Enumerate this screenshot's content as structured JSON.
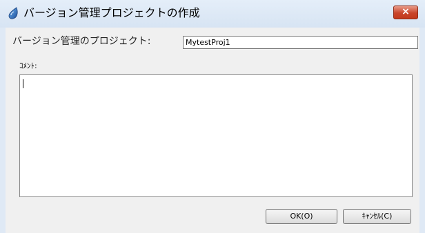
{
  "window": {
    "title": "バージョン管理プロジェクトの作成",
    "close_glyph": "×",
    "icon": "droplet-app-icon"
  },
  "form": {
    "project_label": "バージョン管理のプロジェクト:",
    "project_value": "MytestProj1",
    "comment_label": "ｺﾒﾝﾄ:",
    "comment_value": ""
  },
  "buttons": {
    "ok_label": "OK(O)",
    "cancel_label": "ｷｬﾝｾﾙ(C)"
  },
  "colors": {
    "close_button": "#c9452a",
    "window_frame": "#dfe9f5",
    "dialog_background": "#f0f0f0"
  }
}
